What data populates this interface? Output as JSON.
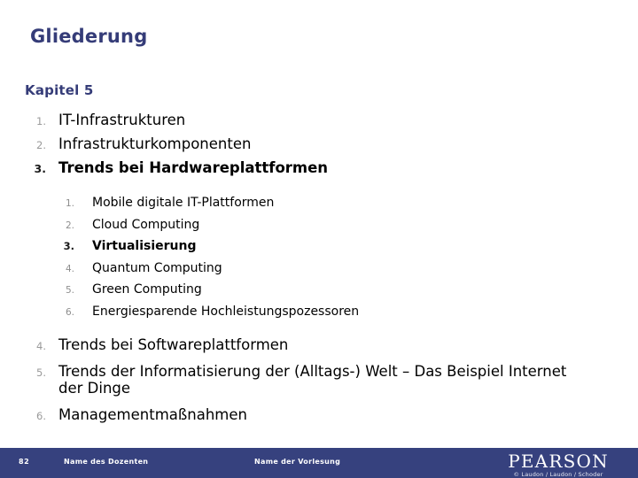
{
  "slide": {
    "title": "Gliederung",
    "chapter_heading": "Kapitel 5",
    "title_color": "#353C78",
    "footer_bg_color": "#36417E",
    "body_bg_color": "#FFFFFF"
  },
  "outline": {
    "level1_top": [
      {
        "number": "1.",
        "label": "IT-Infrastrukturen",
        "bold": false
      },
      {
        "number": "2.",
        "label": "Infrastrukturkomponenten",
        "bold": false
      },
      {
        "number": "3.",
        "label": "Trends bei Hardwareplattformen",
        "bold": true
      }
    ],
    "level2": [
      {
        "number": "1.",
        "label": "Mobile digitale IT-Plattformen",
        "bold": false
      },
      {
        "number": "2.",
        "label": "Cloud Computing",
        "bold": false
      },
      {
        "number": "3.",
        "label": "Virtualisierung",
        "bold": true
      },
      {
        "number": "4.",
        "label": "Quantum Computing",
        "bold": false
      },
      {
        "number": "5.",
        "label": "Green Computing",
        "bold": false
      },
      {
        "number": "6.",
        "label": "Energiesparende Hochleistungspozessoren",
        "bold": false
      }
    ],
    "level1_bottom": [
      {
        "number": "4.",
        "label": "Trends bei Softwareplattformen",
        "bold": false
      },
      {
        "number": "5.",
        "label": "Trends der Informatisierung der (Alltags-) Welt – Das Beispiel Internet der Dinge",
        "bold": false
      },
      {
        "number": "6.",
        "label": "Managementmaßnahmen",
        "bold": false
      }
    ]
  },
  "footer": {
    "page_number": "82",
    "lecturer_label": "Name des Dozenten",
    "lecture_label": "Name der Vorlesung",
    "brand_name": "PEARSON",
    "brand_credit": "© Laudon / Laudon / Schoder"
  }
}
